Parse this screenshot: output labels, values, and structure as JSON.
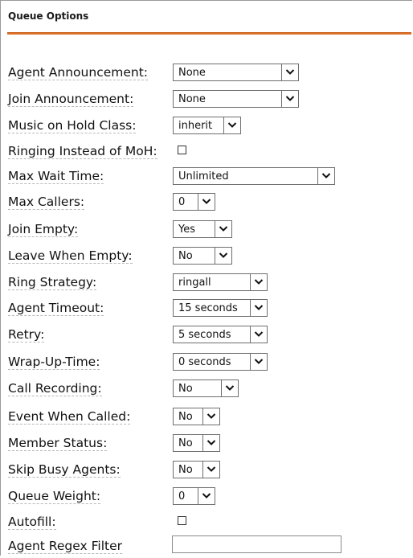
{
  "section": {
    "title": "Queue Options"
  },
  "rows": [
    {
      "label": "Agent Announcement:",
      "value": "None"
    },
    {
      "label": "Join Announcement:",
      "value": "None"
    },
    {
      "label": "Music on Hold Class:",
      "value": "inherit"
    },
    {
      "label": "Ringing Instead of MoH:",
      "checked": false
    },
    {
      "label": "Max Wait Time:",
      "value": "Unlimited"
    },
    {
      "label": "Max Callers:",
      "value": "0"
    },
    {
      "label": "Join Empty:",
      "value": "Yes"
    },
    {
      "label": "Leave When Empty:",
      "value": "No"
    },
    {
      "label": "Ring Strategy:",
      "value": "ringall"
    },
    {
      "label": "Agent Timeout:",
      "value": "15 seconds"
    },
    {
      "label": "Retry:",
      "value": "5 seconds"
    },
    {
      "label": "Wrap-Up-Time:",
      "value": "0 seconds"
    },
    {
      "label": "Call Recording:",
      "value": "No"
    },
    {
      "label": "Event When Called:",
      "value": "No"
    },
    {
      "label": "Member Status:",
      "value": "No"
    },
    {
      "label": "Skip Busy Agents:",
      "value": "No"
    },
    {
      "label": "Queue Weight:",
      "value": "0"
    },
    {
      "label": "Autofill:",
      "checked": false
    },
    {
      "label": "Agent Regex Filter",
      "value": ""
    }
  ],
  "icons": {
    "dropdown": "chevron-down-icon"
  },
  "colors": {
    "header_rule": "#d9661f"
  }
}
